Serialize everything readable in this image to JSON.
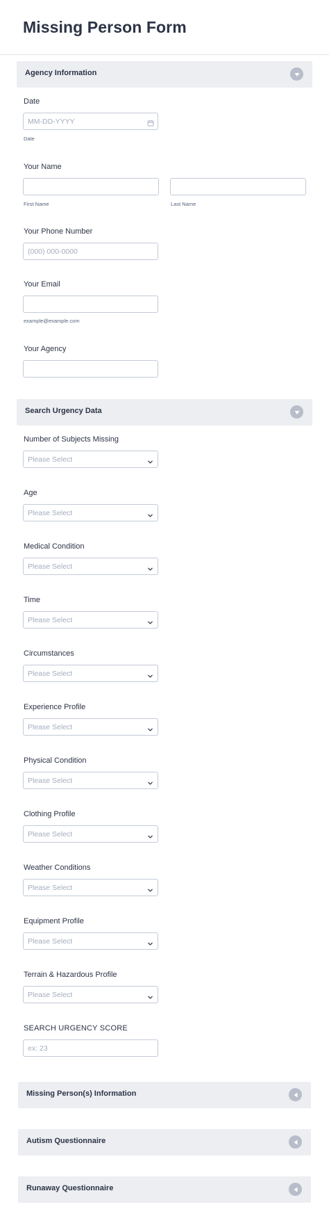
{
  "form": {
    "title": "Missing Person Form"
  },
  "sections": {
    "agency": {
      "title": "Agency Information"
    },
    "urgency": {
      "title": "Search Urgency Data"
    },
    "missing": {
      "title": "Missing Person(s) Information"
    },
    "autism": {
      "title": "Autism Questionnaire"
    },
    "runaway": {
      "title": "Runaway Questionnaire"
    }
  },
  "fields": {
    "date": {
      "label": "Date",
      "placeholder": "MM-DD-YYYY",
      "sublabel": "Date",
      "icon": "calendar-icon"
    },
    "name": {
      "label": "Your Name",
      "first_sublabel": "First Name",
      "last_sublabel": "Last Name"
    },
    "phone": {
      "label": "Your Phone Number",
      "placeholder": "(000) 000-0000"
    },
    "email": {
      "label": "Your Email",
      "sublabel": "example@example.com"
    },
    "agency": {
      "label": "Your Agency"
    },
    "subjects_missing": {
      "label": "Number of Subjects Missing",
      "value": "Please Select"
    },
    "age": {
      "label": "Age",
      "value": "Please Select"
    },
    "medical": {
      "label": "Medical Condition",
      "value": "Please Select"
    },
    "time": {
      "label": "Time",
      "value": "Please Select"
    },
    "circumstances": {
      "label": "Circumstances",
      "value": "Please Select"
    },
    "experience": {
      "label": "Experience Profile",
      "value": "Please Select"
    },
    "physical": {
      "label": "Physical Condition",
      "value": "Please Select"
    },
    "clothing": {
      "label": "Clothing Profile",
      "value": "Please Select"
    },
    "weather": {
      "label": "Weather Conditions",
      "value": "Please Select"
    },
    "equipment": {
      "label": "Equipment Profile",
      "value": "Please Select"
    },
    "terrain": {
      "label": "Terrain & Hazardous Profile",
      "value": "Please Select"
    },
    "score": {
      "label": "SEARCH URGENCY SCORE",
      "placeholder": "ex: 23"
    }
  },
  "colors": {
    "section_bg": "#eceef2",
    "toggle_bg": "#b8bdc9",
    "input_border": "#c3cad8",
    "text": "#2c3345",
    "placeholder": "#a4acbd"
  }
}
